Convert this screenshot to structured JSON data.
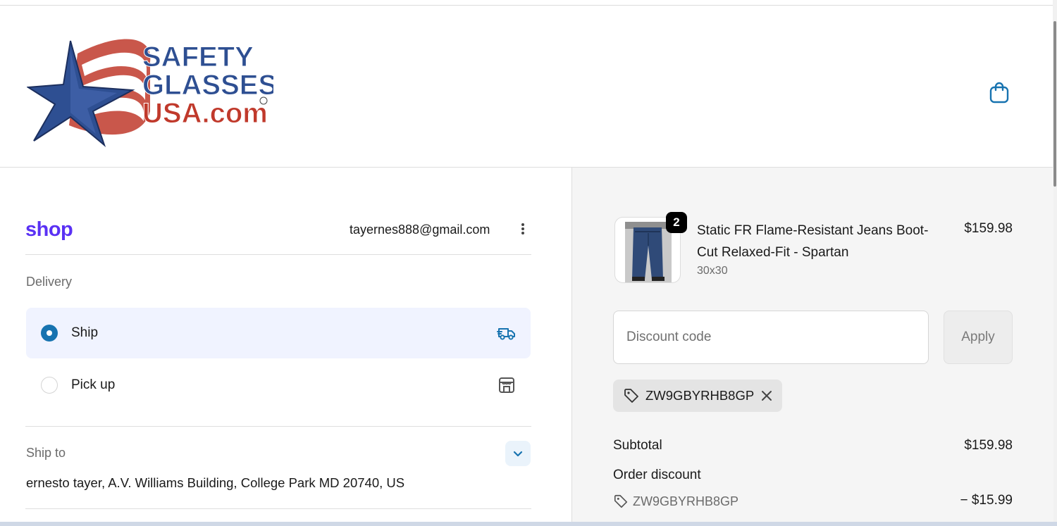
{
  "header": {
    "logo": {
      "line1": "SAFETY",
      "line2": "GLASSES",
      "line3": "USA.com"
    },
    "cart_icon": "shopping-bag-icon"
  },
  "contact": {
    "brand": "shop",
    "email": "tayernes888@gmail.com",
    "menu_icon": "more-vertical-icon"
  },
  "delivery": {
    "label": "Delivery",
    "options": [
      {
        "label": "Ship",
        "selected": true,
        "icon": "truck-icon"
      },
      {
        "label": "Pick up",
        "selected": false,
        "icon": "store-icon"
      }
    ]
  },
  "ship_to": {
    "label": "Ship to",
    "address": "ernesto tayer, A.V. Williams Building, College Park MD 20740, US",
    "toggle_icon": "chevron-down-icon"
  },
  "order": {
    "item": {
      "quantity": "2",
      "title": "Static FR Flame-Resistant Jeans Boot-Cut Relaxed-Fit - Spartan",
      "variant": "30x30",
      "price": "$159.98"
    },
    "discount": {
      "placeholder": "Discount code",
      "apply_label": "Apply",
      "applied_code": "ZW9GBYRHB8GP"
    },
    "summary": {
      "subtotal_label": "Subtotal",
      "subtotal_value": "$159.98",
      "discount_label": "Order discount",
      "discount_code": "ZW9GBYRHB8GP",
      "discount_value": "− $15.99"
    }
  },
  "colors": {
    "accent": "#1773b0",
    "shop_brand": "#5a31f4",
    "selected_bg": "#f0f3ff",
    "summary_bg": "#f5f5f5"
  }
}
